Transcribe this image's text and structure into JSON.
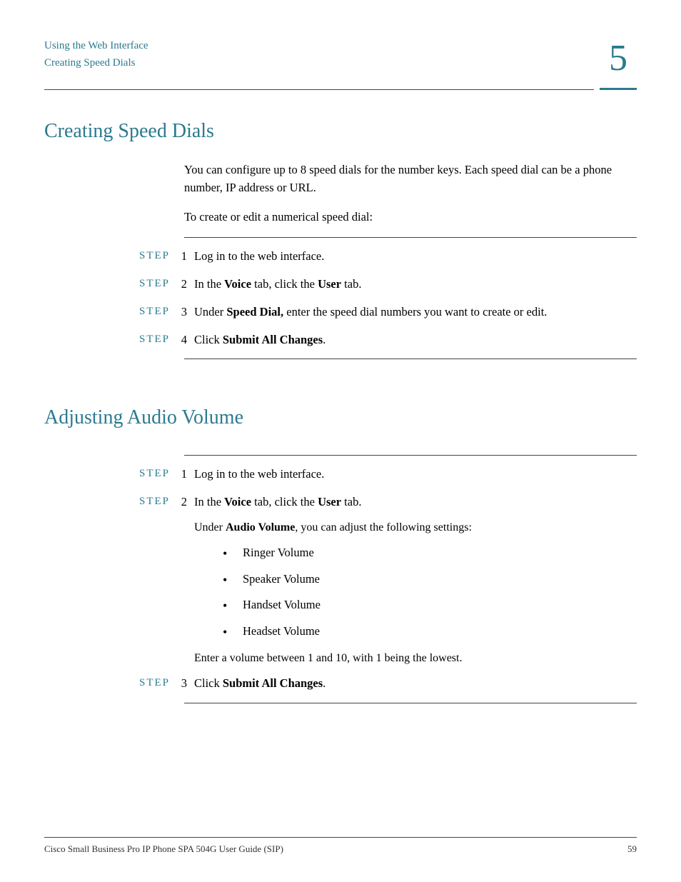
{
  "header": {
    "breadcrumb1": "Using the Web Interface",
    "breadcrumb2": "Creating Speed Dials",
    "chapter": "5"
  },
  "section1": {
    "title": "Creating Speed Dials",
    "intro1": "You can configure up to 8 speed dials for the number keys. Each speed dial can be a phone number, IP address or URL.",
    "intro2": "To create or edit a numerical speed dial:",
    "step_label": "STEP",
    "steps": [
      {
        "n": "1",
        "html": "Log in to the web interface."
      },
      {
        "n": "2",
        "html": "In the <b>Voice</b> tab, click the <b>User</b> tab."
      },
      {
        "n": "3",
        "html": "Under <b>Speed Dial,</b> enter the speed dial numbers you want to create or edit."
      },
      {
        "n": "4",
        "html": "Click <b>Submit All Changes</b>."
      }
    ]
  },
  "section2": {
    "title": "Adjusting Audio Volume",
    "step_label": "STEP",
    "steps": [
      {
        "n": "1",
        "html": "Log in to the web interface."
      },
      {
        "n": "2",
        "html": "In the <b>Voice</b> tab, click the <b>User</b> tab."
      }
    ],
    "under_text": "Under <b>Audio Volume</b>, you can adjust the following settings:",
    "bullets": [
      "Ringer Volume",
      "Speaker Volume",
      "Handset Volume",
      "Headset Volume"
    ],
    "after_bullets": "Enter a volume between 1 and 10, with 1 being the lowest.",
    "step3": {
      "n": "3",
      "html": "Click <b>Submit All Changes</b>."
    }
  },
  "footer": {
    "left": "Cisco Small Business Pro IP Phone SPA 504G User Guide (SIP)",
    "right": "59"
  }
}
